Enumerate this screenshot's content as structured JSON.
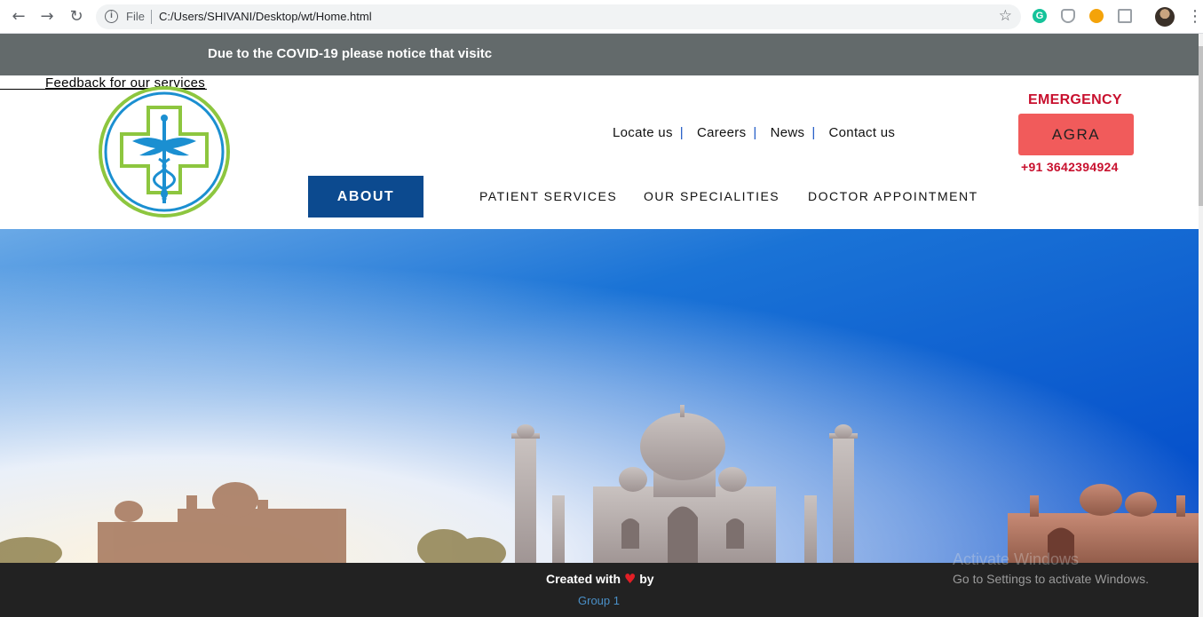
{
  "browser": {
    "file_label": "File",
    "url": "C:/Users/SHIVANI/Desktop/wt/Home.html",
    "icons": [
      "back-icon",
      "forward-icon",
      "reload-icon",
      "info-icon",
      "star-icon",
      "grammarly-icon",
      "shield-icon",
      "worker-icon",
      "doc-icon",
      "avatar",
      "menu-dots-icon"
    ]
  },
  "banner": {
    "text": "Due to the COVID-19 please notice that visitc"
  },
  "header": {
    "feedback_link": "Feedback for our services",
    "top_links": [
      "Locate us",
      "Careers",
      "News",
      "Contact us"
    ],
    "separator": "|",
    "emergency_label": "EMERGENCY",
    "city_button": "AGRA",
    "emergency_phone": "+91 3642394924"
  },
  "nav": {
    "about": "ABOUT",
    "patient_services": "PATIENT SERVICES",
    "our_specialities": "OUR SPECIALITIES",
    "doctor_appointment": "DOCTOR APPOINTMENT"
  },
  "footer": {
    "created_with": "Created with",
    "heart": "♥",
    "by": "by",
    "group": "Group 1"
  },
  "windows_watermark": {
    "title": "Activate Windows",
    "subtitle": "Go to Settings to activate Windows."
  },
  "colors": {
    "banner_bg": "#636a6b",
    "emergency_red": "#c8102e",
    "city_button_bg": "#f15b5b",
    "about_bg": "#0c4a8f",
    "footer_bg": "#222222",
    "logo_green": "#8dc63f",
    "logo_blue": "#1b8fd1"
  }
}
